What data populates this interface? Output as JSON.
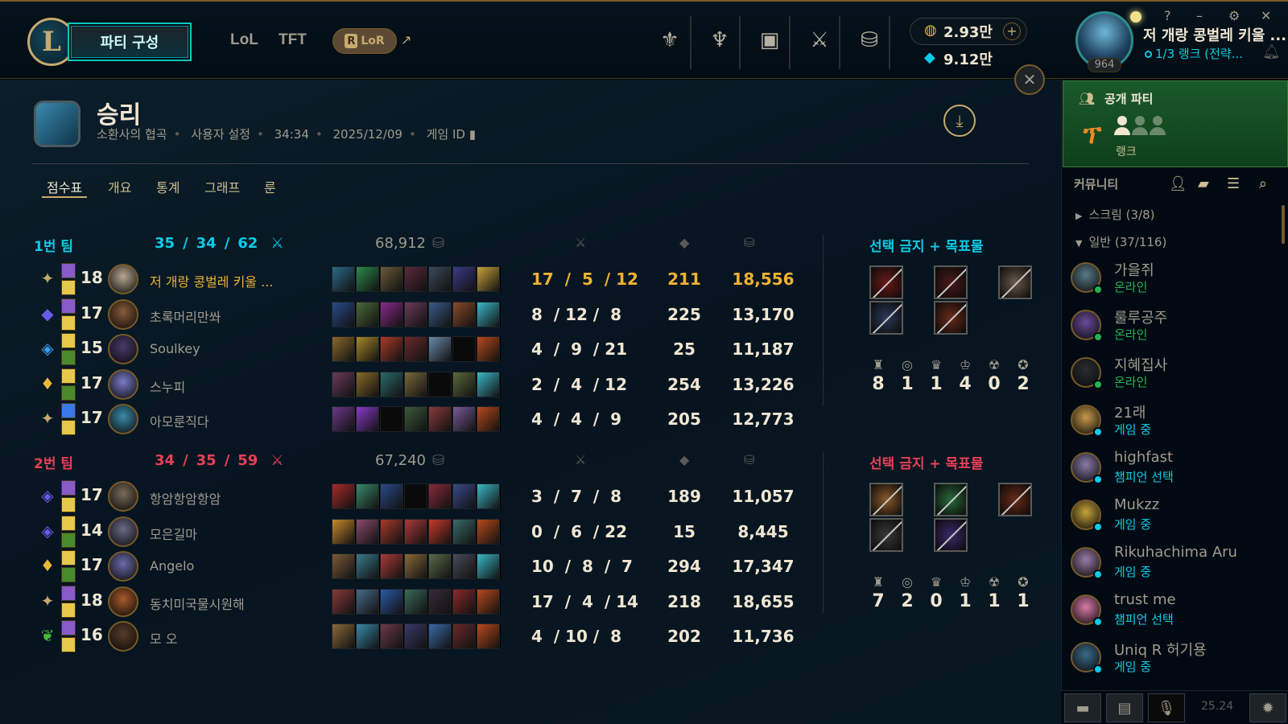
{
  "nav": {
    "party_button": "파티 구성",
    "tabs": [
      "LoL",
      "TFT"
    ],
    "lor_label": "LoR",
    "lor_letter": "R",
    "external_arrow": "↗",
    "icons": [
      "worlds-icon",
      "clash-icon",
      "loot-icon",
      "collection-icon",
      "store-icon"
    ],
    "currency": {
      "rp": "2.93만",
      "be": "9.12만",
      "plus": "+"
    },
    "profile": {
      "name": "저 개랑 콩벌레 키울 ...",
      "level": "964",
      "status": "1/3 랭크 (전략...",
      "status_color": "#0acbe6"
    },
    "window_controls": [
      "?",
      "–",
      "⚙",
      "✕"
    ]
  },
  "result": {
    "title": "승리",
    "map": "소환사의 협곡",
    "mode": "사용자 설정",
    "duration": "34:34",
    "date": "2025/12/09",
    "game_id_label": "게임 ID",
    "close": "✕",
    "download": "⤓"
  },
  "subtabs": [
    "점수표",
    "개요",
    "통계",
    "그래프",
    "룬"
  ],
  "teams": [
    {
      "label": "1번 팀",
      "color": "#0acbe6",
      "kills": "35",
      "deaths": "34",
      "assists": "62",
      "gold": "68,912",
      "bans_title": "선택 금지 + 목표물",
      "ban_colors": [
        "#6a1a18",
        "#4a1a1a",
        "#6a5a4a",
        "#2a3a5a",
        "#6a2a1a"
      ],
      "objectives": [
        "8",
        "1",
        "1",
        "4",
        "0",
        "2"
      ],
      "players": [
        {
          "rune": "✦",
          "rune_color": "#c8aa6e",
          "spell_colors": [
            "#8a5ac8",
            "#e8c84a"
          ],
          "level": "18",
          "champ_color": "#b8a890",
          "name": "저 개랑 콩벌레 키울 ...",
          "me": true,
          "items": [
            "#2a6a8a",
            "#2a8a4a",
            "#6a5a3a",
            "#5a2a3a",
            "#3a4a5a",
            "#3a3a8a",
            "#c8a23a"
          ],
          "kda": "17  /  5  / 12",
          "cs": "211",
          "gold": "18,556"
        },
        {
          "rune": "◆",
          "rune_color": "#6a5ae8",
          "spell_colors": [
            "#8a5ac8",
            "#e8c84a"
          ],
          "level": "17",
          "champ_color": "#8a5a3a",
          "name": "초록머리만쏴",
          "me": false,
          "items": [
            "#2a4a8a",
            "#4a6a3a",
            "#8a2a8a",
            "#6a3a5a",
            "#3a5a8a",
            "#8a4a2a",
            "#3ab8c8"
          ],
          "kda": "8  / 12 /  8",
          "cs": "225",
          "gold": "13,170"
        },
        {
          "rune": "◈",
          "rune_color": "#3a9ae8",
          "spell_colors": [
            "#e8c84a",
            "#4a8a2a"
          ],
          "level": "15",
          "champ_color": "#4a3a6a",
          "name": "Soulkey",
          "me": false,
          "items": [
            "#8a6a2a",
            "#a8882a",
            "#aa3a2a",
            "#6a2a2a",
            "#6a8aaa",
            "#0a0a0a",
            "#b84a1a"
          ],
          "kda": "4  /  9  / 21",
          "cs": "25",
          "gold": "11,187"
        },
        {
          "rune": "♦",
          "rune_color": "#e8b83a",
          "spell_colors": [
            "#e8c84a",
            "#4a8a2a"
          ],
          "level": "17",
          "champ_color": "#7a7ac8",
          "name": "스누피",
          "me": false,
          "items": [
            "#6a3a5a",
            "#8a6a2a",
            "#2a6a6a",
            "#7a6a3a",
            "#0a0a0a",
            "#5a6a3a",
            "#3ab8c8"
          ],
          "kda": "2  /  4  / 12",
          "cs": "254",
          "gold": "13,226"
        },
        {
          "rune": "✦",
          "rune_color": "#c8aa6e",
          "spell_colors": [
            "#3a7ae8",
            "#e8c84a"
          ],
          "level": "17",
          "champ_color": "#3a8aaa",
          "name": "아모룬직다",
          "me": false,
          "items": [
            "#6a3a8a",
            "#8a3ac8",
            "#0a0a0a",
            "#3a5a3a",
            "#8a3a3a",
            "#7a5a9a",
            "#b84a1a"
          ],
          "kda": "4  /  4  /  9",
          "cs": "205",
          "gold": "12,773"
        }
      ]
    },
    {
      "label": "2번 팀",
      "color": "#e84057",
      "kills": "34",
      "deaths": "35",
      "assists": "59",
      "gold": "67,240",
      "bans_title": "선택 금지 + 목표물",
      "ban_colors": [
        "#8a5a2a",
        "#2a6a3a",
        "#6a2a1a",
        "#3a3a3a",
        "#3a2a6a"
      ],
      "objectives": [
        "7",
        "2",
        "0",
        "1",
        "1",
        "1"
      ],
      "players": [
        {
          "rune": "◈",
          "rune_color": "#6a5ae8",
          "spell_colors": [
            "#8a5ac8",
            "#e8c84a"
          ],
          "level": "17",
          "champ_color": "#7a6a5a",
          "name": "항암항암항암",
          "me": false,
          "items": [
            "#a82a2a",
            "#3a8a6a",
            "#2a4a8a",
            "#0a0a0a",
            "#8a2a3a",
            "#3a4a8a",
            "#3ab8c8"
          ],
          "kda": "3  /  7  /  8",
          "cs": "189",
          "gold": "11,057"
        },
        {
          "rune": "◈",
          "rune_color": "#6a5ae8",
          "spell_colors": [
            "#e8c84a",
            "#4a8a2a"
          ],
          "level": "14",
          "champ_color": "#6a6a8a",
          "name": "모은길마",
          "me": false,
          "items": [
            "#c88a2a",
            "#8a4a6a",
            "#a83a2a",
            "#aa3a3a",
            "#c83a2a",
            "#3a6a6a",
            "#b84a1a"
          ],
          "kda": "0  /  6  / 22",
          "cs": "15",
          "gold": "8,445"
        },
        {
          "rune": "♦",
          "rune_color": "#e8b83a",
          "spell_colors": [
            "#e8c84a",
            "#4a8a2a"
          ],
          "level": "17",
          "champ_color": "#6a6aaa",
          "name": "Angelo",
          "me": false,
          "items": [
            "#7a5a3a",
            "#3a7a8a",
            "#aa3a3a",
            "#8a6a3a",
            "#5a6a4a",
            "#4a4a5a",
            "#3ab8c8"
          ],
          "kda": "10  /  8  /  7",
          "cs": "294",
          "gold": "17,347"
        },
        {
          "rune": "✦",
          "rune_color": "#c8aa6e",
          "spell_colors": [
            "#8a5ac8",
            "#e8c84a"
          ],
          "level": "18",
          "champ_color": "#aa5a2a",
          "name": "동치미국물시원해",
          "me": false,
          "items": [
            "#8a3a3a",
            "#4a6a8a",
            "#2a5aa8",
            "#3a6a5a",
            "#3a2a3a",
            "#8a2a2a",
            "#b84a1a"
          ],
          "kda": "17  /  4  / 14",
          "cs": "218",
          "gold": "18,655"
        },
        {
          "rune": "❦",
          "rune_color": "#4ab83a",
          "spell_colors": [
            "#8a5ac8",
            "#e8c84a"
          ],
          "level": "16",
          "champ_color": "#5a3a2a",
          "name": "모 오",
          "me": false,
          "items": [
            "#8a6a3a",
            "#3a8aaa",
            "#6a3a4a",
            "#3a3a6a",
            "#3a6aa8",
            "#6a2a2a",
            "#b84a1a"
          ],
          "kda": "4  / 10 /  8",
          "cs": "202",
          "gold": "11,736"
        }
      ]
    }
  ],
  "sidebar": {
    "party_title": "공개 파티",
    "party_rank": "랭크",
    "community_title": "커뮤니티",
    "groups": [
      "스크림 (3/8)",
      "일반 (37/116)"
    ],
    "friends": [
      {
        "name": "가을쥐",
        "status": "온라인",
        "status_color": "#23b450",
        "avatar": "#5a7a8a"
      },
      {
        "name": "룰루공주",
        "status": "온라인",
        "status_color": "#23b450",
        "avatar": "#6a4a9a"
      },
      {
        "name": "지혜집사",
        "status": "온라인",
        "status_color": "#23b450",
        "avatar": "#2a2e32"
      },
      {
        "name": "21래",
        "status": "게임 중",
        "status_color": "#0acbe6",
        "avatar": "#c89a4a"
      },
      {
        "name": "highfast",
        "status": "챔피언 선택",
        "status_color": "#0acbe6",
        "avatar": "#8a7aaa"
      },
      {
        "name": "Mukzz",
        "status": "게임 중",
        "status_color": "#0acbe6",
        "avatar": "#c8a23a"
      },
      {
        "name": "Rikuhachima Aru",
        "status": "게임 중",
        "status_color": "#0acbe6",
        "avatar": "#9a7aa8"
      },
      {
        "name": "trust me",
        "status": "챔피언 선택",
        "status_color": "#0acbe6",
        "avatar": "#d87aa8"
      },
      {
        "name": "Uniq R 허기용",
        "status": "게임 중",
        "status_color": "#0acbe6",
        "avatar": "#3a6a8a"
      }
    ],
    "version": "25.24"
  }
}
